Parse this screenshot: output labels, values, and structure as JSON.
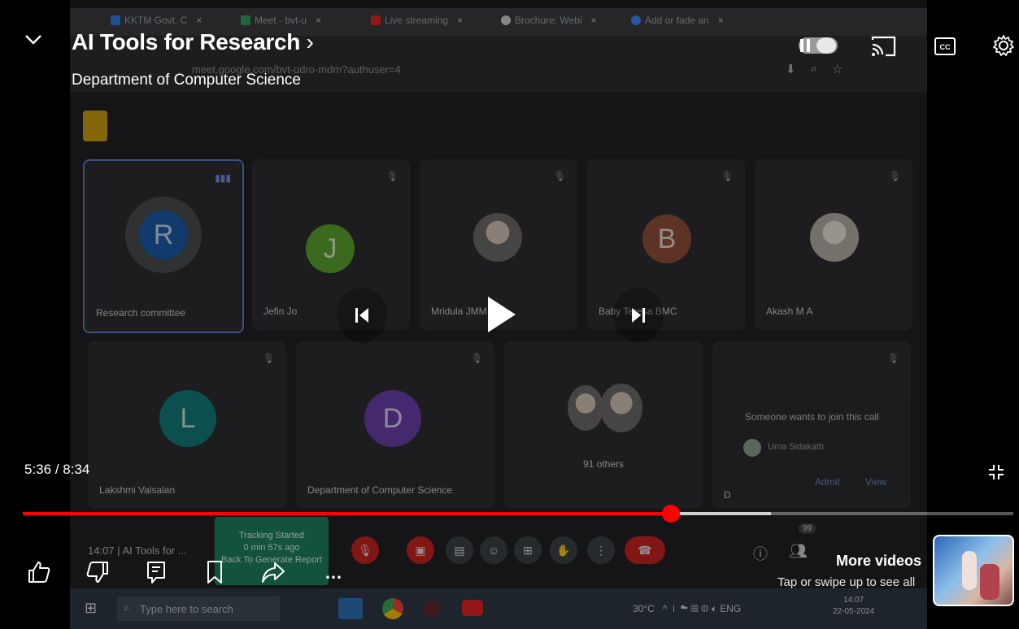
{
  "video": {
    "title": "AI Tools for Research",
    "title_chevron": "›",
    "channel": "Department of Computer Science",
    "current_time": "5:36",
    "duration": "8:34",
    "time_separator": " / ",
    "progress_fraction": 0.654,
    "buffered_fraction": 0.755
  },
  "player": {
    "more_videos": "More videos",
    "more_videos_hint": "Tap or swipe up to see all",
    "icons": [
      "collapse-icon",
      "pause-icon",
      "autoplay-toggle",
      "cast-icon",
      "captions-icon",
      "settings-icon",
      "previous-icon",
      "play-icon",
      "next-icon",
      "exit-fullscreen-icon",
      "like-icon",
      "dislike-icon",
      "comments-icon",
      "save-icon",
      "share-icon",
      "more-icon"
    ],
    "accent": "#ff0000"
  },
  "browser": {
    "tabs": [
      {
        "label": "KKTM Govt. C",
        "color": "#2e7dd7"
      },
      {
        "label": "Meet - bvt-u",
        "color": "#2f9e5b"
      },
      {
        "label": "Live streaming",
        "color": "#e02424"
      },
      {
        "label": "Brochure: Webi",
        "color": "#cccccc"
      },
      {
        "label": "Add or fade an",
        "color": "#4285f4"
      }
    ],
    "url": "meet.google.com/bvt-udro-mdm?authuser=4"
  },
  "meet": {
    "participants_row1": [
      {
        "name": "Research committee",
        "initial": "R",
        "color": "#1a5aa6"
      },
      {
        "name": "Jefin Jo",
        "initial": "J",
        "color": "#5aa02c"
      },
      {
        "name": "Mridula JMM",
        "initial": "",
        "color": ""
      },
      {
        "name": "Baby Teresa BMC",
        "initial": "B",
        "color": "#8e4e3a"
      },
      {
        "name": "Akash M A",
        "initial": "",
        "color": ""
      }
    ],
    "participants_row2": [
      {
        "name": "Lakshmi Valsalan",
        "initial": "L",
        "color": "#127a78"
      },
      {
        "name": "Department of Computer Science",
        "initial": "D",
        "color": "#6a3fa8"
      },
      {
        "name": "91 others",
        "initial": "",
        "color": ""
      },
      {
        "name": "D",
        "initial": "",
        "color": ""
      }
    ],
    "join_request": {
      "title": "Someone wants to join this call",
      "person": "Uma Sidakath",
      "admit": "Admit",
      "view": "View"
    },
    "meeting_time": "14:07",
    "meeting_title": "AI Tools for ...",
    "tracking_line1": "Tracking Started",
    "tracking_line2": "0 min 57s ago",
    "tracking_line3": "Back To Generate Report",
    "people_count": "99"
  },
  "taskbar": {
    "search_placeholder": "Type here to search",
    "temperature": "30°C",
    "language": "ENG",
    "clock": "14:07",
    "date": "22-05-2024"
  }
}
